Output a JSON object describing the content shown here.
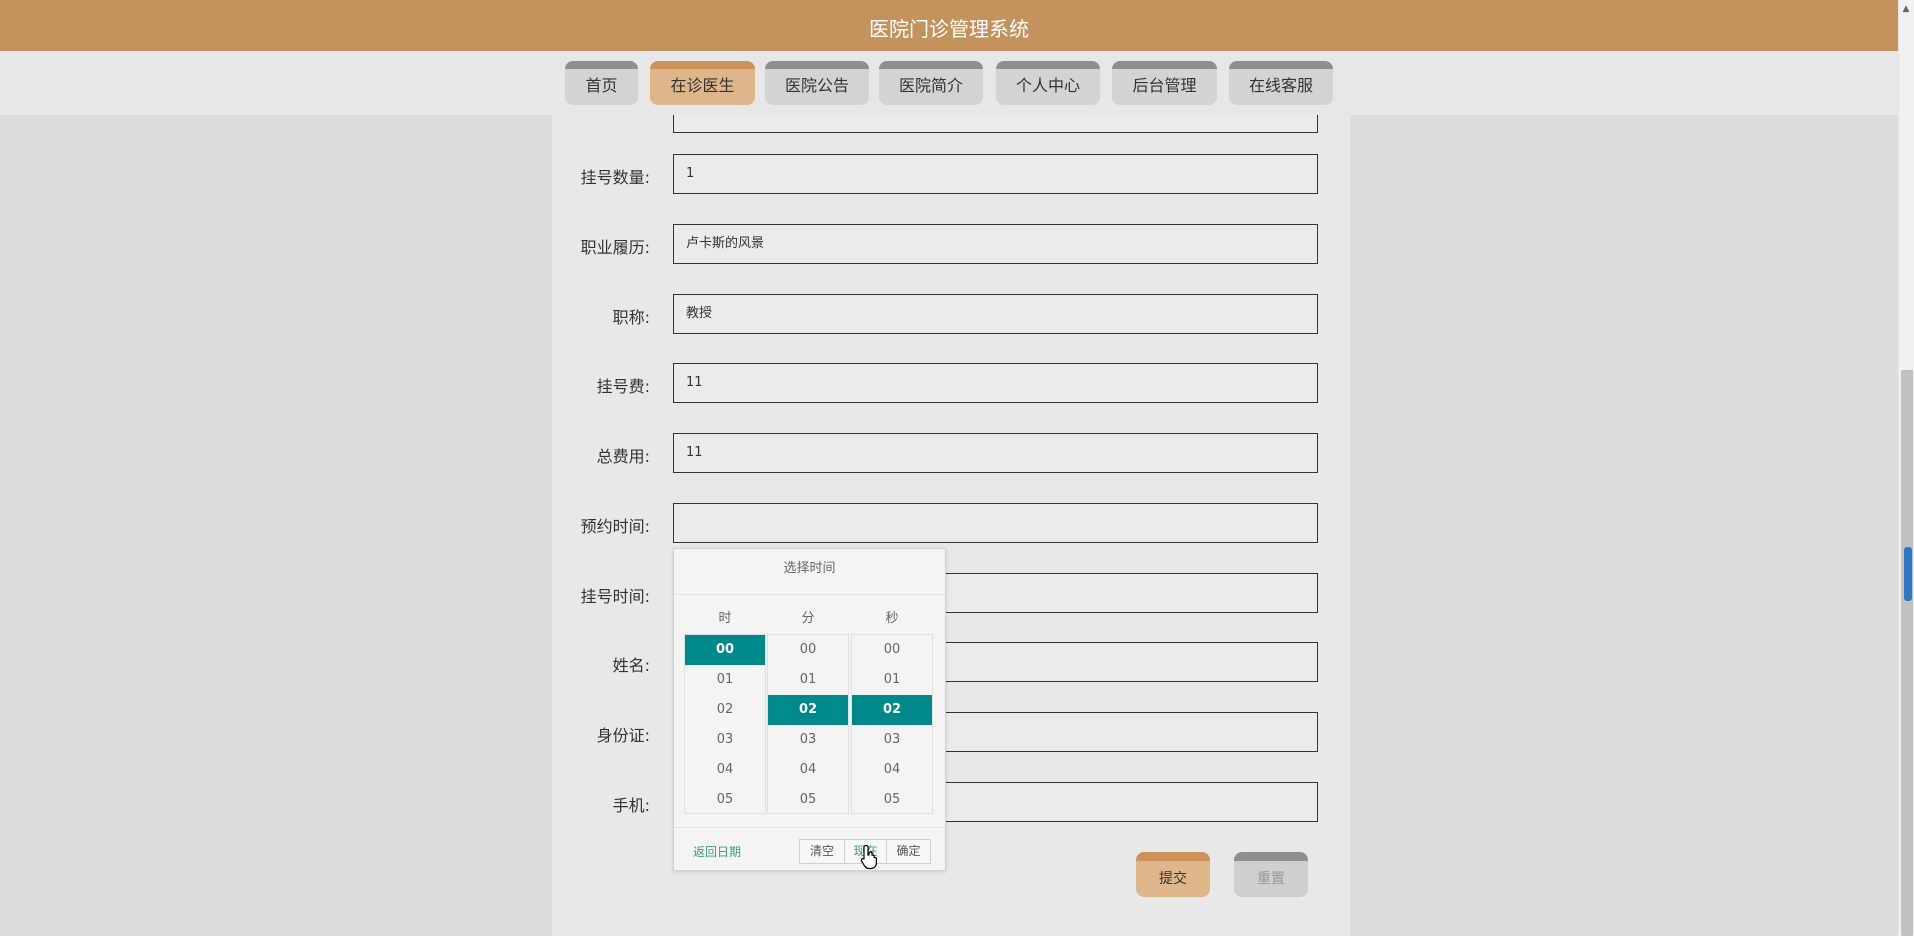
{
  "app": {
    "title": "医院门诊管理系统"
  },
  "nav": {
    "tabs": [
      {
        "label": "首页",
        "active": false
      },
      {
        "label": "在诊医生",
        "active": true
      },
      {
        "label": "医院公告",
        "active": false
      },
      {
        "label": "医院简介",
        "active": false
      },
      {
        "label": "个人中心",
        "active": false
      },
      {
        "label": "后台管理",
        "active": false
      },
      {
        "label": "在线客服",
        "active": false
      }
    ]
  },
  "form": {
    "fields": [
      {
        "label": "挂号数量:",
        "value": "1"
      },
      {
        "label": "职业履历:",
        "value": "卢卡斯的风景"
      },
      {
        "label": "职称:",
        "value": "教授"
      },
      {
        "label": "挂号费:",
        "value": "11"
      },
      {
        "label": "总费用:",
        "value": "11"
      },
      {
        "label": "预约时间:",
        "value": ""
      },
      {
        "label": "挂号时间:",
        "value": ""
      },
      {
        "label": "姓名:",
        "value": ""
      },
      {
        "label": "身份证:",
        "value": ""
      },
      {
        "label": "手机:",
        "value": ""
      }
    ],
    "submit_label": "提交",
    "reset_label": "重置"
  },
  "time_picker": {
    "title": "选择时间",
    "columns": [
      {
        "header": "时",
        "values": [
          "00",
          "01",
          "02",
          "03",
          "04",
          "05"
        ],
        "selected": "00"
      },
      {
        "header": "分",
        "values": [
          "00",
          "01",
          "02",
          "03",
          "04",
          "05"
        ],
        "selected": "02"
      },
      {
        "header": "秒",
        "values": [
          "00",
          "01",
          "02",
          "03",
          "04",
          "05"
        ],
        "selected": "02"
      }
    ],
    "back_label": "返回日期",
    "clear_label": "清空",
    "now_label": "现在",
    "confirm_label": "确定"
  },
  "colors": {
    "header": "#c4925c",
    "active_tab": "#ddb78a",
    "picker_selected": "#00898b",
    "link": "#3a9e6a"
  },
  "icons": {
    "cursor": "hand-pointer-icon"
  }
}
